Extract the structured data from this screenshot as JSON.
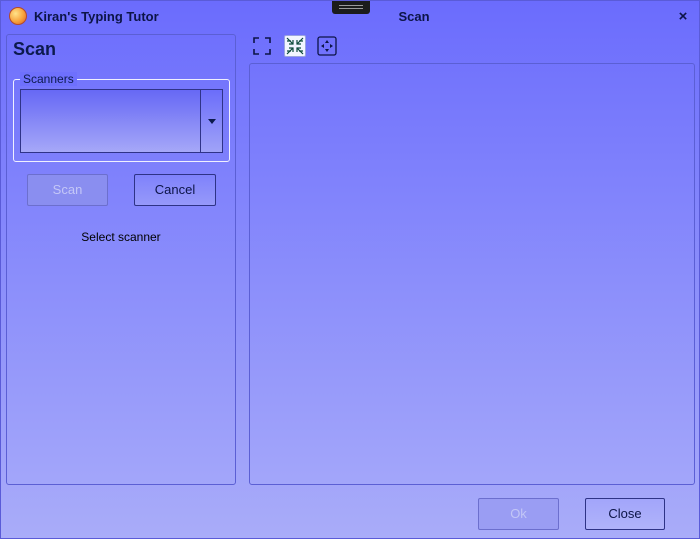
{
  "window": {
    "app_title": "Kiran's Typing Tutor",
    "title": "Scan",
    "close_glyph": "×"
  },
  "icons": {
    "app": "app-logo-icon",
    "fit": "fit-to-window-icon",
    "actual_size": "actual-size-icon",
    "move": "move-icon"
  },
  "left_panel": {
    "heading": "Scan",
    "group_label": "Scanners",
    "scan_button": "Scan",
    "cancel_button": "Cancel",
    "status": "Select scanner"
  },
  "footer": {
    "ok_button": "Ok",
    "close_button": "Close"
  },
  "colors": {
    "accent_dark": "#0c1447",
    "window_bg_top": "#6b6cfd",
    "window_bg_bottom": "#a9acf9"
  }
}
